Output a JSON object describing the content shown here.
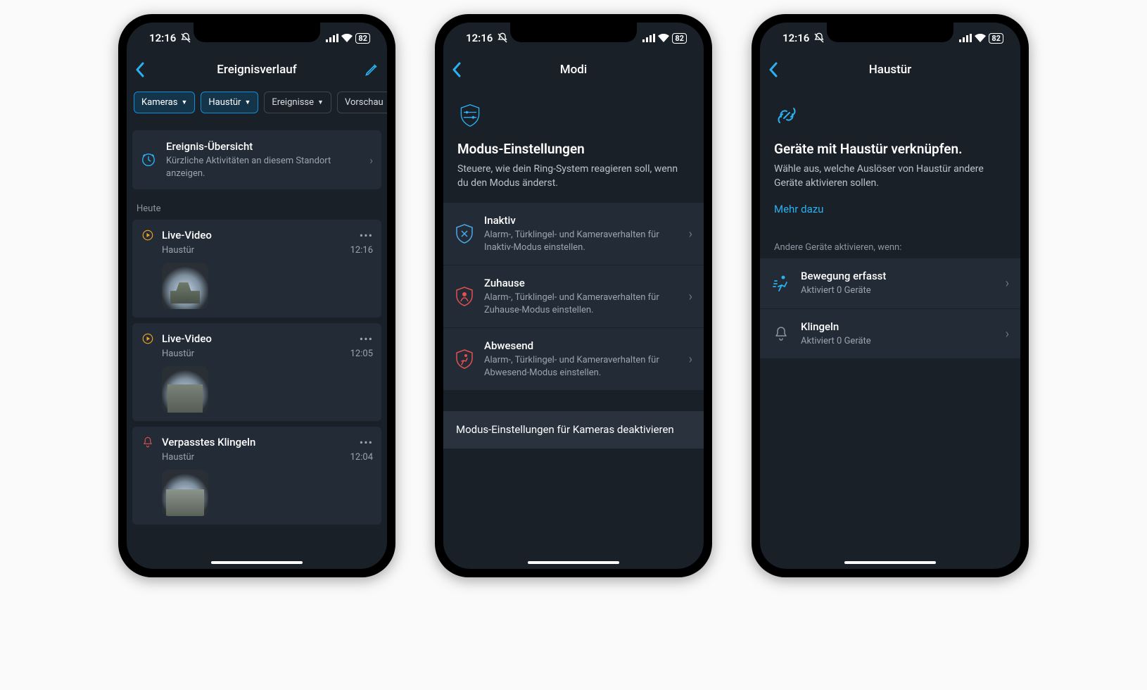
{
  "status": {
    "time": "12:16",
    "battery": "82"
  },
  "screen1": {
    "title": "Ereignisverlauf",
    "filters": [
      {
        "label": "Kameras",
        "active": true
      },
      {
        "label": "Haustür",
        "active": true
      },
      {
        "label": "Ereignisse",
        "active": false
      },
      {
        "label": "Vorschau",
        "active": false
      }
    ],
    "overview": {
      "title": "Ereignis-Übersicht",
      "sub": "Kürzliche Aktivitäten an diesem Standort anzeigen."
    },
    "today_label": "Heute",
    "events": [
      {
        "type": "live",
        "title": "Live-Video",
        "device": "Haustür",
        "time": "12:16",
        "thumb": "house"
      },
      {
        "type": "live",
        "title": "Live-Video",
        "device": "Haustür",
        "time": "12:05",
        "thumb": "path"
      },
      {
        "type": "ring",
        "title": "Verpasstes Klingeln",
        "device": "Haustür",
        "time": "12:04",
        "thumb": "walk"
      }
    ]
  },
  "screen2": {
    "title": "Modi",
    "heading": "Modus-Einstellungen",
    "sub": "Steuere, wie dein Ring-System reagieren soll, wenn du den Modus änderst.",
    "modes": [
      {
        "name": "Inaktiv",
        "desc": "Alarm-, Türklingel- und Kameraverhalten für Inaktiv-Modus einstellen.",
        "color": "#4aa9e8",
        "icon": "shield-x"
      },
      {
        "name": "Zuhause",
        "desc": "Alarm-, Türklingel- und Kameraverhalten für Zuhause-Modus einstellen.",
        "color": "#e2514f",
        "icon": "shield-person"
      },
      {
        "name": "Abwesend",
        "desc": "Alarm-, Türklingel- und Kameraverhalten für Abwesend-Modus einstellen.",
        "color": "#e2514f",
        "icon": "shield-run"
      }
    ],
    "footer": "Modus-Einstellungen für Kameras deaktivieren"
  },
  "screen3": {
    "title": "Haustür",
    "heading": "Geräte mit Haustür verknüpfen.",
    "sub": "Wähle aus, welche Auslöser von Haustür andere Geräte aktivieren sollen.",
    "link": "Mehr dazu",
    "section": "Andere Geräte aktivieren, wenn:",
    "triggers": [
      {
        "title": "Bewegung erfasst",
        "sub": "Aktiviert 0 Geräte",
        "icon": "motion"
      },
      {
        "title": "Klingeln",
        "sub": "Aktiviert 0 Geräte",
        "icon": "bell"
      }
    ]
  }
}
